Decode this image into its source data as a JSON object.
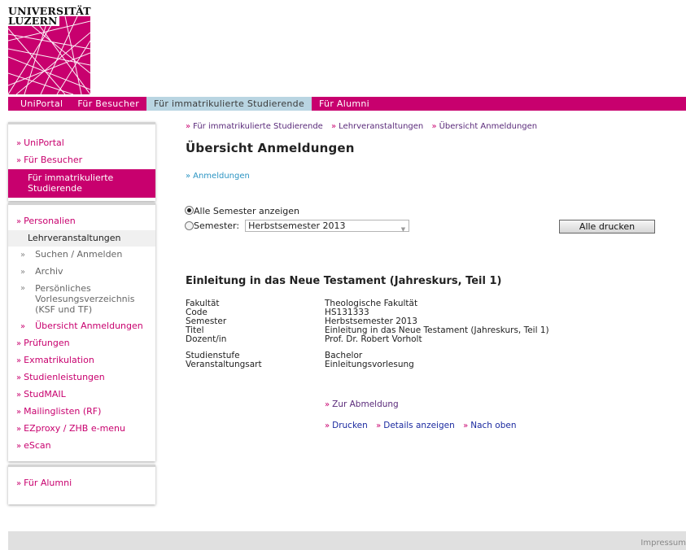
{
  "logo": {
    "line1": "UNIVERSITÄT",
    "line2": "LUZERN"
  },
  "topnav": {
    "items": [
      {
        "label": "UniPortal"
      },
      {
        "label": "Für Besucher"
      },
      {
        "label": "Für immatrikulierte Studierende"
      },
      {
        "label": "Für Alumni"
      }
    ]
  },
  "sidebar": {
    "group1": [
      {
        "label": "UniPortal"
      },
      {
        "label": "Für Besucher"
      },
      {
        "label": "Für immatrikulierte Studierende"
      }
    ],
    "group2": {
      "personalien": "Personalien",
      "lehrveranstaltungen": "Lehrveranstaltungen",
      "sub": [
        {
          "label": "Suchen / Anmelden"
        },
        {
          "label": "Archiv"
        },
        {
          "label": "Persönliches Vorlesungsverzeichnis (KSF und TF)"
        },
        {
          "label": "Übersicht Anmeldungen"
        }
      ],
      "items": [
        {
          "label": "Prüfungen"
        },
        {
          "label": "Exmatrikulation"
        },
        {
          "label": "Studienleistungen"
        },
        {
          "label": "StudMAIL"
        },
        {
          "label": "Mailinglisten (RF)"
        },
        {
          "label": "EZproxy / ZHB e-menu"
        },
        {
          "label": "eScan"
        }
      ]
    },
    "group3": [
      {
        "label": "Für Alumni"
      }
    ]
  },
  "breadcrumb": [
    {
      "label": "Für immatrikulierte Studierende"
    },
    {
      "label": "Lehrveranstaltungen"
    },
    {
      "label": "Übersicht Anmeldungen"
    }
  ],
  "page_title": "Übersicht Anmeldungen",
  "anmeldungen_link": "Anmeldungen",
  "filter": {
    "all_label": "Alle Semester anzeigen",
    "semester_label": "Semester:",
    "semester_value": "Herbstsemester 2013",
    "print_all": "Alle drucken"
  },
  "course": {
    "title": "Einleitung in das Neue Testament (Jahreskurs, Teil 1)",
    "details": [
      {
        "label": "Fakultät",
        "value": "Theologische Fakultät"
      },
      {
        "label": "Code",
        "value": "HS131333"
      },
      {
        "label": "Semester",
        "value": "Herbstsemester 2013"
      },
      {
        "label": "Titel",
        "value": "Einleitung in das Neue Testament (Jahreskurs, Teil 1)"
      },
      {
        "label": "Dozent/in",
        "value": "Prof. Dr. Robert Vorholt"
      }
    ],
    "details2": [
      {
        "label": "Studienstufe",
        "value": "Bachelor"
      },
      {
        "label": "Veranstaltungsart",
        "value": "Einleitungsvorlesung"
      }
    ],
    "abmeldung": "Zur Abmeldung",
    "actions": [
      {
        "label": "Drucken"
      },
      {
        "label": "Details anzeigen"
      },
      {
        "label": "Nach oben"
      }
    ]
  },
  "footer": {
    "impressum": "Impressum"
  },
  "colors": {
    "brand": "#c8006e",
    "active_tab": "#b9d5e2",
    "link_blue": "#2b94c3"
  }
}
